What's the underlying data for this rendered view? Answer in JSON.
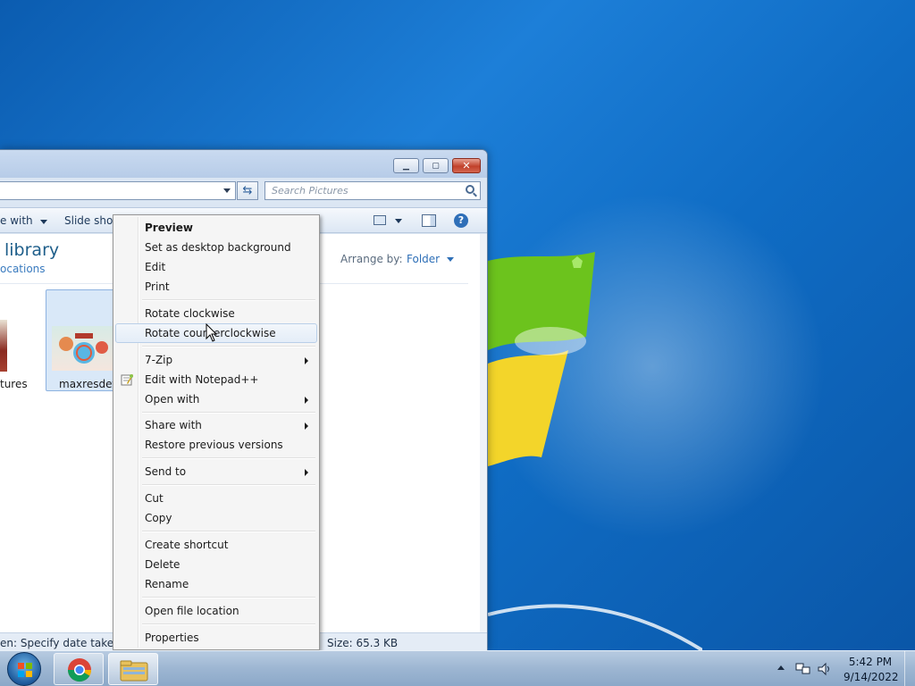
{
  "explorer": {
    "search_placeholder": "Search Pictures",
    "toolbar": {
      "share_with": "e with",
      "slide_show": "Slide show"
    },
    "library_title": "library",
    "library_subtitle": "ocations",
    "arrange_label": "Arrange by:",
    "arrange_value": "Folder",
    "files": [
      {
        "name": "tures"
      },
      {
        "name": "maxresdefa"
      }
    ],
    "status_left": "en: Specify date taken",
    "status_right": "Size: 65.3 KB"
  },
  "context_menu": {
    "items": [
      {
        "label": "Preview",
        "bold": true
      },
      {
        "label": "Set as desktop background"
      },
      {
        "label": "Edit"
      },
      {
        "label": "Print"
      },
      {
        "label": "Rotate clockwise"
      },
      {
        "label": "Rotate counterclockwise",
        "hovered": true
      },
      {
        "label": "7-Zip",
        "submenu": true
      },
      {
        "label": "Edit with Notepad++",
        "icon": "notepadpp-icon"
      },
      {
        "label": "Open with",
        "submenu": true
      },
      {
        "label": "Share with",
        "submenu": true
      },
      {
        "label": "Restore previous versions"
      },
      {
        "label": "Send to",
        "submenu": true
      },
      {
        "label": "Cut"
      },
      {
        "label": "Copy"
      },
      {
        "label": "Create shortcut"
      },
      {
        "label": "Delete"
      },
      {
        "label": "Rename"
      },
      {
        "label": "Open file location"
      },
      {
        "label": "Properties"
      }
    ]
  },
  "taskbar": {
    "apps": [
      "chrome-icon",
      "windows-explorer-icon"
    ],
    "clock_time": "5:42 PM",
    "clock_date": "9/14/2022"
  },
  "colors": {
    "desktop": "#1d7fd8",
    "link": "#2e6fb7",
    "library_title": "#1e5e8a"
  }
}
